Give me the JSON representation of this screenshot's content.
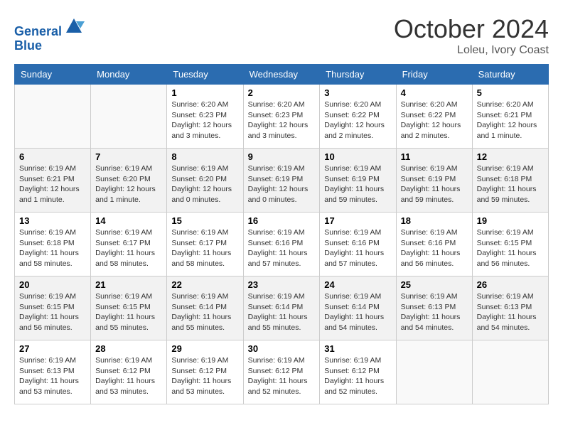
{
  "header": {
    "logo_line1": "General",
    "logo_line2": "Blue",
    "month": "October 2024",
    "location": "Loleu, Ivory Coast"
  },
  "weekdays": [
    "Sunday",
    "Monday",
    "Tuesday",
    "Wednesday",
    "Thursday",
    "Friday",
    "Saturday"
  ],
  "weeks": [
    [
      {
        "day": "",
        "info": ""
      },
      {
        "day": "",
        "info": ""
      },
      {
        "day": "1",
        "info": "Sunrise: 6:20 AM\nSunset: 6:23 PM\nDaylight: 12 hours and 3 minutes."
      },
      {
        "day": "2",
        "info": "Sunrise: 6:20 AM\nSunset: 6:23 PM\nDaylight: 12 hours and 3 minutes."
      },
      {
        "day": "3",
        "info": "Sunrise: 6:20 AM\nSunset: 6:22 PM\nDaylight: 12 hours and 2 minutes."
      },
      {
        "day": "4",
        "info": "Sunrise: 6:20 AM\nSunset: 6:22 PM\nDaylight: 12 hours and 2 minutes."
      },
      {
        "day": "5",
        "info": "Sunrise: 6:20 AM\nSunset: 6:21 PM\nDaylight: 12 hours and 1 minute."
      }
    ],
    [
      {
        "day": "6",
        "info": "Sunrise: 6:19 AM\nSunset: 6:21 PM\nDaylight: 12 hours and 1 minute."
      },
      {
        "day": "7",
        "info": "Sunrise: 6:19 AM\nSunset: 6:20 PM\nDaylight: 12 hours and 1 minute."
      },
      {
        "day": "8",
        "info": "Sunrise: 6:19 AM\nSunset: 6:20 PM\nDaylight: 12 hours and 0 minutes."
      },
      {
        "day": "9",
        "info": "Sunrise: 6:19 AM\nSunset: 6:19 PM\nDaylight: 12 hours and 0 minutes."
      },
      {
        "day": "10",
        "info": "Sunrise: 6:19 AM\nSunset: 6:19 PM\nDaylight: 11 hours and 59 minutes."
      },
      {
        "day": "11",
        "info": "Sunrise: 6:19 AM\nSunset: 6:19 PM\nDaylight: 11 hours and 59 minutes."
      },
      {
        "day": "12",
        "info": "Sunrise: 6:19 AM\nSunset: 6:18 PM\nDaylight: 11 hours and 59 minutes."
      }
    ],
    [
      {
        "day": "13",
        "info": "Sunrise: 6:19 AM\nSunset: 6:18 PM\nDaylight: 11 hours and 58 minutes."
      },
      {
        "day": "14",
        "info": "Sunrise: 6:19 AM\nSunset: 6:17 PM\nDaylight: 11 hours and 58 minutes."
      },
      {
        "day": "15",
        "info": "Sunrise: 6:19 AM\nSunset: 6:17 PM\nDaylight: 11 hours and 58 minutes."
      },
      {
        "day": "16",
        "info": "Sunrise: 6:19 AM\nSunset: 6:16 PM\nDaylight: 11 hours and 57 minutes."
      },
      {
        "day": "17",
        "info": "Sunrise: 6:19 AM\nSunset: 6:16 PM\nDaylight: 11 hours and 57 minutes."
      },
      {
        "day": "18",
        "info": "Sunrise: 6:19 AM\nSunset: 6:16 PM\nDaylight: 11 hours and 56 minutes."
      },
      {
        "day": "19",
        "info": "Sunrise: 6:19 AM\nSunset: 6:15 PM\nDaylight: 11 hours and 56 minutes."
      }
    ],
    [
      {
        "day": "20",
        "info": "Sunrise: 6:19 AM\nSunset: 6:15 PM\nDaylight: 11 hours and 56 minutes."
      },
      {
        "day": "21",
        "info": "Sunrise: 6:19 AM\nSunset: 6:15 PM\nDaylight: 11 hours and 55 minutes."
      },
      {
        "day": "22",
        "info": "Sunrise: 6:19 AM\nSunset: 6:14 PM\nDaylight: 11 hours and 55 minutes."
      },
      {
        "day": "23",
        "info": "Sunrise: 6:19 AM\nSunset: 6:14 PM\nDaylight: 11 hours and 55 minutes."
      },
      {
        "day": "24",
        "info": "Sunrise: 6:19 AM\nSunset: 6:14 PM\nDaylight: 11 hours and 54 minutes."
      },
      {
        "day": "25",
        "info": "Sunrise: 6:19 AM\nSunset: 6:13 PM\nDaylight: 11 hours and 54 minutes."
      },
      {
        "day": "26",
        "info": "Sunrise: 6:19 AM\nSunset: 6:13 PM\nDaylight: 11 hours and 54 minutes."
      }
    ],
    [
      {
        "day": "27",
        "info": "Sunrise: 6:19 AM\nSunset: 6:13 PM\nDaylight: 11 hours and 53 minutes."
      },
      {
        "day": "28",
        "info": "Sunrise: 6:19 AM\nSunset: 6:12 PM\nDaylight: 11 hours and 53 minutes."
      },
      {
        "day": "29",
        "info": "Sunrise: 6:19 AM\nSunset: 6:12 PM\nDaylight: 11 hours and 53 minutes."
      },
      {
        "day": "30",
        "info": "Sunrise: 6:19 AM\nSunset: 6:12 PM\nDaylight: 11 hours and 52 minutes."
      },
      {
        "day": "31",
        "info": "Sunrise: 6:19 AM\nSunset: 6:12 PM\nDaylight: 11 hours and 52 minutes."
      },
      {
        "day": "",
        "info": ""
      },
      {
        "day": "",
        "info": ""
      }
    ]
  ]
}
